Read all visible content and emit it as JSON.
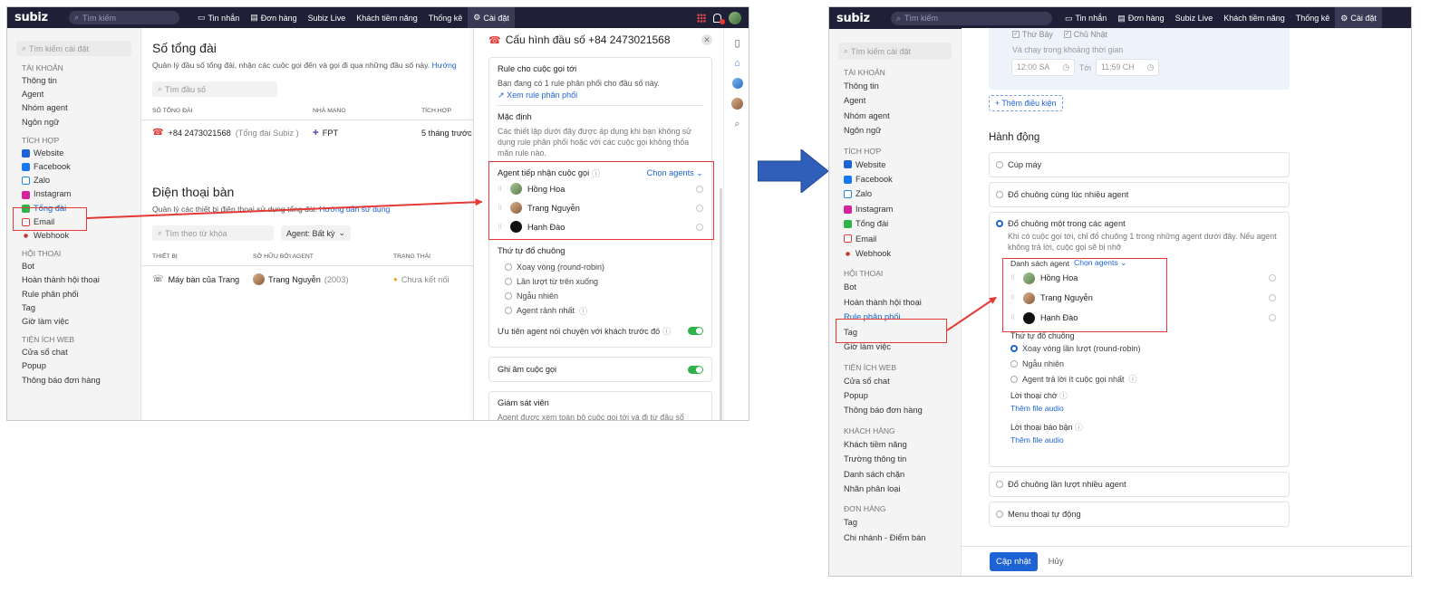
{
  "left": {
    "topbar": {
      "logo": "subiz",
      "search_placeholder": "Tìm kiếm",
      "nav": [
        {
          "label": "Tin nhắn"
        },
        {
          "label": "Đơn hàng"
        },
        {
          "label": "Subiz Live"
        },
        {
          "label": "Khách tiềm năng"
        },
        {
          "label": "Thống kê"
        },
        {
          "label": "Cài đặt"
        }
      ]
    },
    "sidebar": {
      "search_placeholder": "Tìm kiếm cài đặt",
      "groups": [
        {
          "title": "TÀI KHOẢN",
          "items": [
            "Thông tin",
            "Agent",
            "Nhóm agent",
            "Ngôn ngữ"
          ]
        },
        {
          "title": "TÍCH HỢP",
          "items": [
            "Website",
            "Facebook",
            "Zalo",
            "Instagram",
            "Tổng đài",
            "Email",
            "Webhook"
          ]
        },
        {
          "title": "HỘI THOẠI",
          "items": [
            "Bot",
            "Hoàn thành hội thoại",
            "Rule phân phối",
            "Tag",
            "Giờ làm việc"
          ]
        },
        {
          "title": "TIỆN ÍCH WEB",
          "items": [
            "Cửa sổ chat",
            "Popup",
            "Thông báo đơn hàng"
          ]
        }
      ]
    },
    "main": {
      "title": "Số tổng đài",
      "subtitle": "Quản lý đầu số tổng đài, nhận các cuộc gọi đến và gọi đi qua những đầu số này.",
      "subtitle_link": "Hướng",
      "search_placeholder": "Tìm đầu số",
      "table_headers": [
        "SỐ TỔNG ĐÀI",
        "NHÀ MẠNG",
        "TÍCH HỢP"
      ],
      "row": {
        "number": "+84 2473021568",
        "number_note": "(Tổng đài Subiz )",
        "carrier": "FPT",
        "integration": "5 tháng trước"
      },
      "desk_title": "Điện thoại bàn",
      "desk_subtitle": "Quản lý các thiết bị điện thoại sử dụng tổng đài.",
      "desk_link": "Hướng dẫn sử dụng",
      "desk_search_placeholder": "Tìm theo từ khóa",
      "desk_filter": "Agent: Bất kỳ",
      "desk_headers": [
        "THIẾT BỊ",
        "SỞ HỮU BỞI AGENT",
        "TRẠNG THÁI"
      ],
      "desk_row": {
        "device": "Máy bàn của Trang",
        "owner": "Trang Nguyễn",
        "owner_note": "(2003)",
        "status": "Chưa kết nối"
      }
    },
    "panel": {
      "title": "Cấu hình đầu số +84 2473021568",
      "rule_title": "Rule cho cuộc gọi tới",
      "rule_desc": "Bạn đang có 1 rule phân phối cho đầu số này.",
      "rule_link": "Xem rule phân phối",
      "default_title": "Mặc định",
      "default_desc": "Các thiết lập dưới đây được áp dụng khi bạn không sử dụng rule phân phối hoặc với các cuộc gọi không thỏa mãn rule nào.",
      "agent_label": "Agent tiếp nhận cuộc gọi",
      "choose_agents": "Chọn agents",
      "agents": [
        "Hồng Hoa",
        "Trang Nguyễn",
        "Hạnh Đào"
      ],
      "order_title": "Thứ tự đổ chuông",
      "order_options": [
        "Xoay vòng (round-robin)",
        "Lần lượt từ trên xuống",
        "Ngẫu nhiên",
        "Agent rảnh nhất"
      ],
      "priority_label": "Ưu tiên agent nói chuyện với khách trước đó",
      "record_label": "Ghi âm cuộc gọi",
      "supervisor_title": "Giám sát viên",
      "supervisor_desc": "Agent được xem toàn bộ cuộc gọi tới và đi từ đầu số"
    }
  },
  "right": {
    "topbar": {
      "logo": "subiz",
      "search_placeholder": "Tìm kiếm",
      "nav": [
        {
          "label": "Tin nhắn"
        },
        {
          "label": "Đơn hàng"
        },
        {
          "label": "Subiz Live"
        },
        {
          "label": "Khách tiềm năng"
        },
        {
          "label": "Thống kê"
        },
        {
          "label": "Cài đặt"
        }
      ]
    },
    "sidebar": {
      "search_placeholder": "Tìm kiếm cài đặt",
      "groups": [
        {
          "title": "TÀI KHOẢN",
          "items": [
            "Thông tin",
            "Agent",
            "Nhóm agent",
            "Ngôn ngữ"
          ]
        },
        {
          "title": "TÍCH HỢP",
          "items": [
            "Website",
            "Facebook",
            "Zalo",
            "Instagram",
            "Tổng đài",
            "Email",
            "Webhook"
          ]
        },
        {
          "title": "HỘI THOẠI",
          "items": [
            "Bot",
            "Hoàn thành hội thoại",
            "Rule phân phối",
            "Tag",
            "Giờ làm việc"
          ]
        },
        {
          "title": "TIỆN ÍCH WEB",
          "items": [
            "Cửa sổ chat",
            "Popup",
            "Thông báo đơn hàng"
          ]
        },
        {
          "title": "KHÁCH HÀNG",
          "items": [
            "Khách tiềm năng",
            "Trường thông tin",
            "Danh sách chặn",
            "Nhãn phân loại"
          ]
        },
        {
          "title": "ĐƠN HÀNG",
          "items": [
            "Tag",
            "Chi nhánh - Điểm bán"
          ]
        }
      ]
    },
    "main": {
      "days": [
        "Thứ Bảy",
        "Chủ Nhật"
      ],
      "time_range_label": "Và chạy trong khoảng thời gian",
      "time_from": "12:00 SA",
      "time_to_label": "Tới",
      "time_to": "11:59 CH",
      "add_condition": "+ Thêm điều kiện",
      "action_title": "Hành động",
      "actions": [
        "Cúp máy",
        "Đổ chuông cùng lúc nhiều agent",
        "Đổ chuông một trong các agent",
        "Đổ chuông lần lượt nhiều agent",
        "Menu thoại tự động"
      ],
      "selected_desc": "Khi có cuộc gọi tới, chỉ đổ chuông 1 trong những agent dưới đây. Nếu agent không trả lời, cuộc gọi sẽ bị nhỡ",
      "agent_list_label": "Danh sách agent",
      "choose_agents": "Chọn agents",
      "agents": [
        "Hồng Hoa",
        "Trang Nguyễn",
        "Hạnh Đào"
      ],
      "order_title": "Thứ tự đổ chuông",
      "order_options": [
        "Xoay vòng lần lượt (round-robin)",
        "Ngẫu nhiên",
        "Agent trả lời ít cuộc gọi nhất"
      ],
      "wait_label": "Lời thoại chờ",
      "busy_label": "Lời thoại báo bận",
      "add_audio": "Thêm file audio",
      "update_btn": "Cập nhật",
      "cancel_btn": "Hủy"
    }
  },
  "colors": {
    "accent": "#1e63d6",
    "highlight": "#e53935",
    "topbar": "#1f1f38",
    "toggle": "#2eb24a",
    "big_arrow": "#2f5fb8"
  }
}
